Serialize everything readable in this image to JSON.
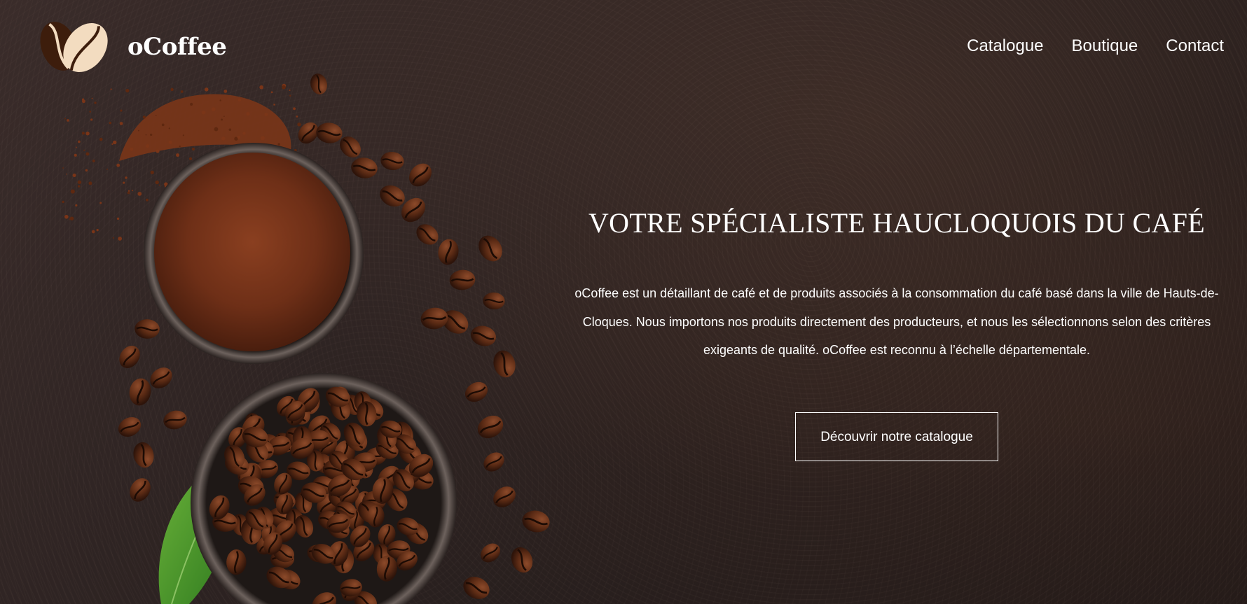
{
  "brand": {
    "name": "oCoffee",
    "logo_icon": "coffee-beans-logo-icon",
    "colors": {
      "bean_dark": "#3d1d0c",
      "bean_light": "#f3dcc0"
    }
  },
  "nav": {
    "items": [
      {
        "label": "Catalogue"
      },
      {
        "label": "Boutique"
      },
      {
        "label": "Contact"
      }
    ]
  },
  "hero": {
    "title": "VOTRE SPÉCIALISTE HAUCLOQUOIS DU CAFÉ",
    "description": "oCoffee est un détaillant de café et de produits associés à la consommation du café basé dans la ville de Hauts-de-Cloques. Nous importons nos produits directement des producteurs, et nous les sélectionnons selon des critères exigeants de qualité. oCoffee est reconnu à l’échelle départementale.",
    "cta_label": "Découvrir notre catalogue",
    "background_image": "coffee-beans-and-ground-coffee-bowls-photo"
  },
  "theme": {
    "background": "#2a2120",
    "text": "#ffffff"
  }
}
